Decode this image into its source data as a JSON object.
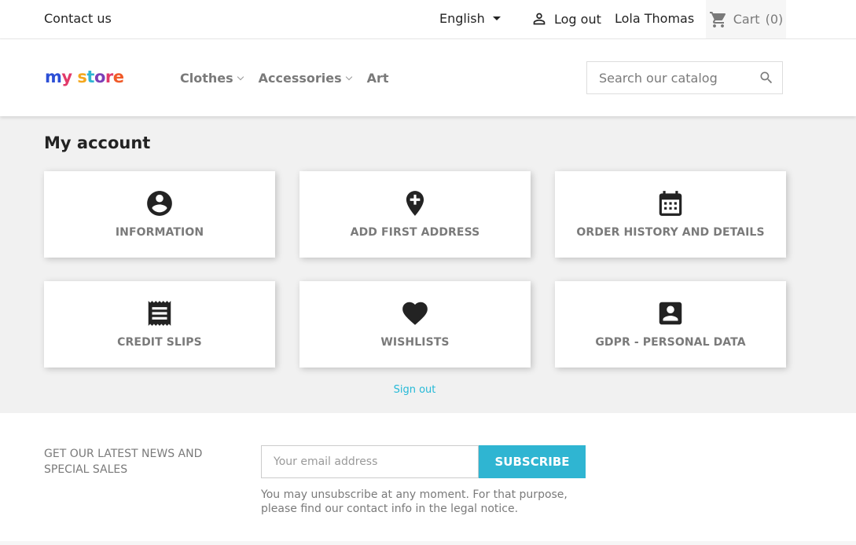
{
  "topbar": {
    "contact_label": "Contact us",
    "language": "English",
    "logout_label": "Log out",
    "user_name": "Lola Thomas",
    "cart_label": "Cart",
    "cart_count": "(0)"
  },
  "header": {
    "logo_text": "my store",
    "nav": [
      {
        "label": "Clothes"
      },
      {
        "label": "Accessories"
      },
      {
        "label": "Art"
      }
    ],
    "search_placeholder": "Search our catalog"
  },
  "main": {
    "title": "My account",
    "cards": [
      {
        "label": "INFORMATION",
        "icon": "account-circle-icon"
      },
      {
        "label": "ADD FIRST ADDRESS",
        "icon": "add-location-icon"
      },
      {
        "label": "ORDER HISTORY AND DETAILS",
        "icon": "calendar-icon"
      },
      {
        "label": "CREDIT SLIPS",
        "icon": "receipt-icon"
      },
      {
        "label": "WISHLISTS",
        "icon": "heart-icon"
      },
      {
        "label": "GDPR - PERSONAL DATA",
        "icon": "account-box-icon"
      }
    ],
    "sign_out": "Sign out"
  },
  "newsletter": {
    "title": "GET OUR LATEST NEWS AND SPECIAL SALES",
    "email_placeholder": "Your email address",
    "subscribe_label": "SUBSCRIBE",
    "note": "You may unsubscribe at any moment. For that purpose, please find our contact info in the legal notice."
  },
  "colors": {
    "accent": "#2fb5d2",
    "link": "#24b9d7",
    "background": "#f1f1f1"
  }
}
